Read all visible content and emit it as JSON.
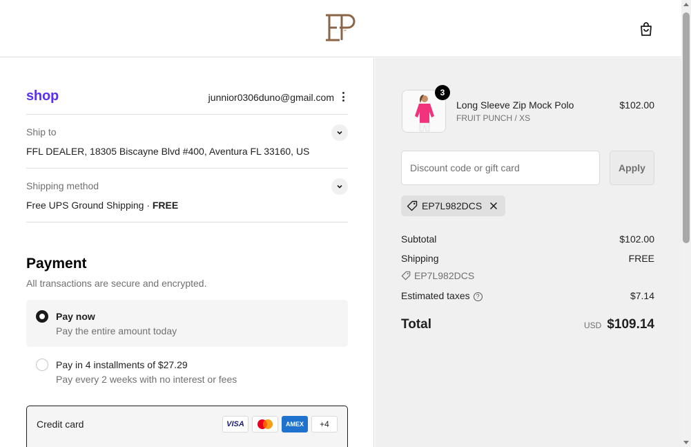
{
  "header": {
    "brand": "EP",
    "cart_icon": "shopping-bag-icon"
  },
  "express": {
    "shop_logo": "shop",
    "email": "junnior0306duno@gmail.com"
  },
  "shipping": {
    "ship_to_label": "Ship to",
    "ship_to_value": "FFL DEALER, 18305 Biscayne Blvd #400, Aventura FL 33160, US",
    "method_label": "Shipping method",
    "method_value": "Free UPS Ground Shipping · ",
    "method_price": "FREE"
  },
  "payment": {
    "title": "Payment",
    "subtitle": "All transactions are secure and encrypted.",
    "options": [
      {
        "title": "Pay now",
        "subtitle": "Pay the entire amount today",
        "selected": true
      },
      {
        "title": "Pay in 4 installments of $27.29",
        "subtitle": "Pay every 2 weeks with no interest or fees",
        "selected": false
      }
    ],
    "credit_card_label": "Credit card",
    "cards": [
      "VISA",
      "Mastercard",
      "AMEX",
      "+4"
    ]
  },
  "summary": {
    "product": {
      "name": "Long Sleeve Zip Mock Polo",
      "variant": "FRUIT PUNCH / XS",
      "price": "$102.00",
      "quantity": "3"
    },
    "discount_placeholder": "Discount code or gift card",
    "apply_label": "Apply",
    "applied_code": "EP7L982DCS",
    "subtotal_label": "Subtotal",
    "subtotal_value": "$102.00",
    "shipping_label": "Shipping",
    "shipping_value": "FREE",
    "discount_code": "EP7L982DCS",
    "taxes_label": "Estimated taxes",
    "taxes_value": "$7.14",
    "total_label": "Total",
    "currency": "USD",
    "total_value": "$109.14"
  },
  "colors": {
    "shop_purple": "#5a31f4",
    "product_pink": "#f0337a",
    "brand_brown": "#8b6446"
  }
}
